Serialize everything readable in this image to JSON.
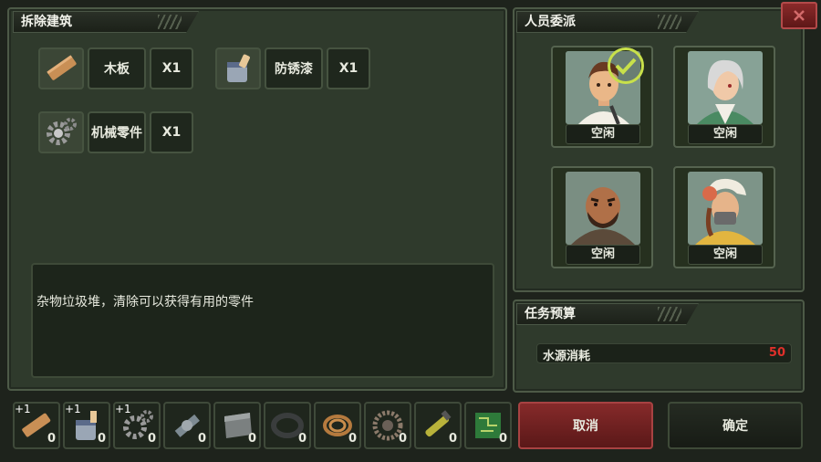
{
  "demolish": {
    "title": "拆除建筑",
    "materials": [
      {
        "name": "木板",
        "qty": "X1",
        "icon": "wood-plank-icon"
      },
      {
        "name": "防锈漆",
        "qty": "X1",
        "icon": "paint-bucket-icon"
      },
      {
        "name": "机械零件",
        "qty": "X1",
        "icon": "gear-icon"
      }
    ],
    "description": "杂物垃圾堆，清除可以获得有用的零件"
  },
  "assign": {
    "title": "人员委派",
    "people": [
      {
        "status": "空闲",
        "selected": true
      },
      {
        "status": "空闲",
        "selected": false
      },
      {
        "status": "空闲",
        "selected": false
      },
      {
        "status": "空闲",
        "selected": false
      }
    ]
  },
  "budget": {
    "title": "任务预算",
    "item_label": "水源消耗",
    "item_value": "50",
    "value_color": "#e0302a"
  },
  "inventory": [
    {
      "icon": "wood-plank-icon",
      "count": "0",
      "plus": "+1"
    },
    {
      "icon": "paint-bucket-icon",
      "count": "0",
      "plus": "+1"
    },
    {
      "icon": "gear-icon",
      "count": "0",
      "plus": "+1"
    },
    {
      "icon": "pipe-valve-icon",
      "count": "0",
      "plus": ""
    },
    {
      "icon": "metal-plate-icon",
      "count": "0",
      "plus": ""
    },
    {
      "icon": "rubber-tire-icon",
      "count": "0",
      "plus": ""
    },
    {
      "icon": "rope-coil-icon",
      "count": "0",
      "plus": ""
    },
    {
      "icon": "cog-wheel-icon",
      "count": "0",
      "plus": ""
    },
    {
      "icon": "drill-tool-icon",
      "count": "0",
      "plus": ""
    },
    {
      "icon": "circuit-board-icon",
      "count": "0",
      "plus": ""
    }
  ],
  "buttons": {
    "cancel": "取消",
    "confirm": "确定"
  },
  "colors": {
    "accent_green": "#c8e04a",
    "cancel_red": "#7a2424",
    "panel": "#2f3a2c"
  }
}
